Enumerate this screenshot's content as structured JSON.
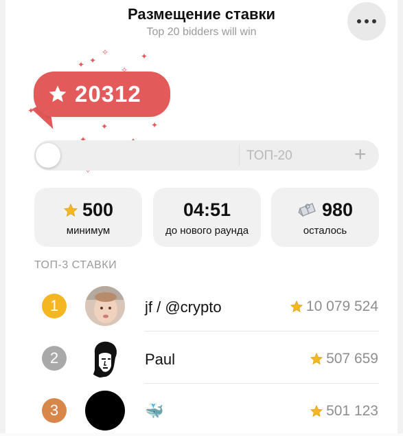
{
  "header": {
    "title": "Размещение ставки",
    "subtitle": "Top 20 bidders will win",
    "more_icon": "more-horizontal-icon"
  },
  "bid": {
    "amount": "20312",
    "icon": "star-icon",
    "color": "#e35a5a"
  },
  "slider": {
    "level": 0,
    "target_label": "ТОП-20",
    "increment_label": "+"
  },
  "stats": [
    {
      "value": "500",
      "caption": "минимум",
      "icon": "star-icon"
    },
    {
      "value": "04:51",
      "caption": "до нового раунда",
      "icon": ""
    },
    {
      "value": "980",
      "caption": "осталось",
      "icon": "gift-icon"
    }
  ],
  "top_bids": {
    "heading": "ТОП-3 СТАВКИ",
    "rows": [
      {
        "rank": "1",
        "rank_color": "#f5b623",
        "name": "jf / @crypto",
        "amount": "10 079 524",
        "avatar": "child-photo-avatar"
      },
      {
        "rank": "2",
        "rank_color": "#a9a9a9",
        "name": "Paul",
        "amount": "507 659",
        "avatar": "face-sketch-avatar"
      },
      {
        "rank": "3",
        "rank_color": "#d8874b",
        "name": "🐳",
        "amount": "501 123",
        "avatar": "black-circle-avatar"
      }
    ]
  }
}
